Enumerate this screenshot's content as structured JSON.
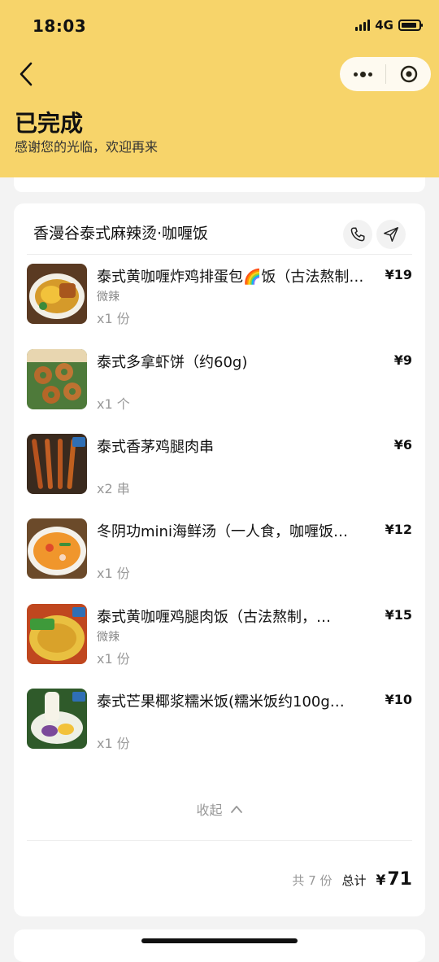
{
  "status": {
    "time": "18:03",
    "network": "4G"
  },
  "header": {
    "title": "已完成",
    "subtitle": "感谢您的光临，欢迎再来"
  },
  "shop": {
    "name": "香漫谷泰式麻辣烫·咖喱饭"
  },
  "items": [
    {
      "name": "泰式黄咖喱炸鸡排蛋包🌈饭（古法熬制…",
      "spec": "微辣",
      "qty": "x1 份",
      "price": "¥19"
    },
    {
      "name": "泰式多拿虾饼（约60g)",
      "spec": "",
      "qty": "x1 个",
      "price": "¥9"
    },
    {
      "name": "泰式香茅鸡腿肉串",
      "spec": "",
      "qty": "x2 串",
      "price": "¥6"
    },
    {
      "name": "冬阴功mini海鲜汤（一人食，咖喱饭…",
      "spec": "",
      "qty": "x1 份",
      "price": "¥12"
    },
    {
      "name": "泰式黄咖喱鸡腿肉饭（古法熬制，…",
      "spec": "微辣",
      "qty": "x1 份",
      "price": "¥15"
    },
    {
      "name": "泰式芒果椰浆糯米饭(糯米饭约100g…",
      "spec": "",
      "qty": "x1 份",
      "price": "¥10"
    }
  ],
  "collapse_label": "收起",
  "summary": {
    "count": "共 7 份",
    "total_label": "总计",
    "currency": "¥",
    "total": "71"
  },
  "colors": {
    "header_bg": "#f7d46a",
    "page_bg": "#f3f3f3"
  },
  "icons": [
    "back-icon",
    "more-icon",
    "target-icon",
    "phone-icon",
    "navigate-icon",
    "chevron-up-icon"
  ]
}
